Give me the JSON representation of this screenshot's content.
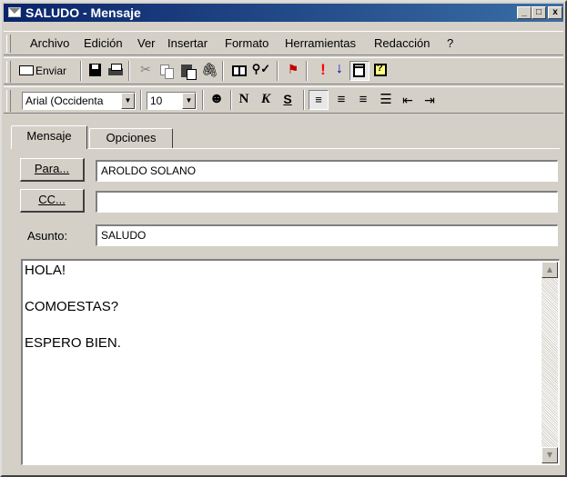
{
  "window": {
    "title": "SALUDO - Mensaje"
  },
  "title_buttons": {
    "minimize": "_",
    "maximize": "□",
    "close": "x"
  },
  "menu": [
    "Archivo",
    "Edición",
    "Ver",
    "Insertar",
    "Formato",
    "Herramientas",
    "Redacción",
    "?"
  ],
  "toolbar": {
    "send_label": "Enviar",
    "icons": [
      "save-icon",
      "print-icon",
      "cut-icon",
      "copy-icon",
      "paste-icon",
      "attach-icon",
      "address-book-icon",
      "check-names-icon",
      "flag-icon",
      "high-importance-icon",
      "low-importance-icon",
      "properties-icon",
      "help-icon"
    ]
  },
  "format": {
    "font": "Arial (Occidenta",
    "size": "10",
    "bold": "N",
    "italic": "K",
    "underline": "S"
  },
  "tabs": {
    "message": "Mensaje",
    "options": "Opciones"
  },
  "header": {
    "to_button": "Para...",
    "to_value": "AROLDO SOLANO",
    "cc_button": "CC...",
    "cc_value": "",
    "subject_label": "Asunto:",
    "subject_value": "SALUDO"
  },
  "message_body": {
    "lines": [
      "HOLA!",
      "COMOESTAS?",
      "ESPERO BIEN."
    ]
  },
  "colors": {
    "titlebar_start": "#0a246a",
    "titlebar_end": "#3a6ea5",
    "face": "#d4d0c8",
    "flag": "#c00000",
    "importance_high": "#ff0000",
    "importance_low": "#0000c0"
  }
}
